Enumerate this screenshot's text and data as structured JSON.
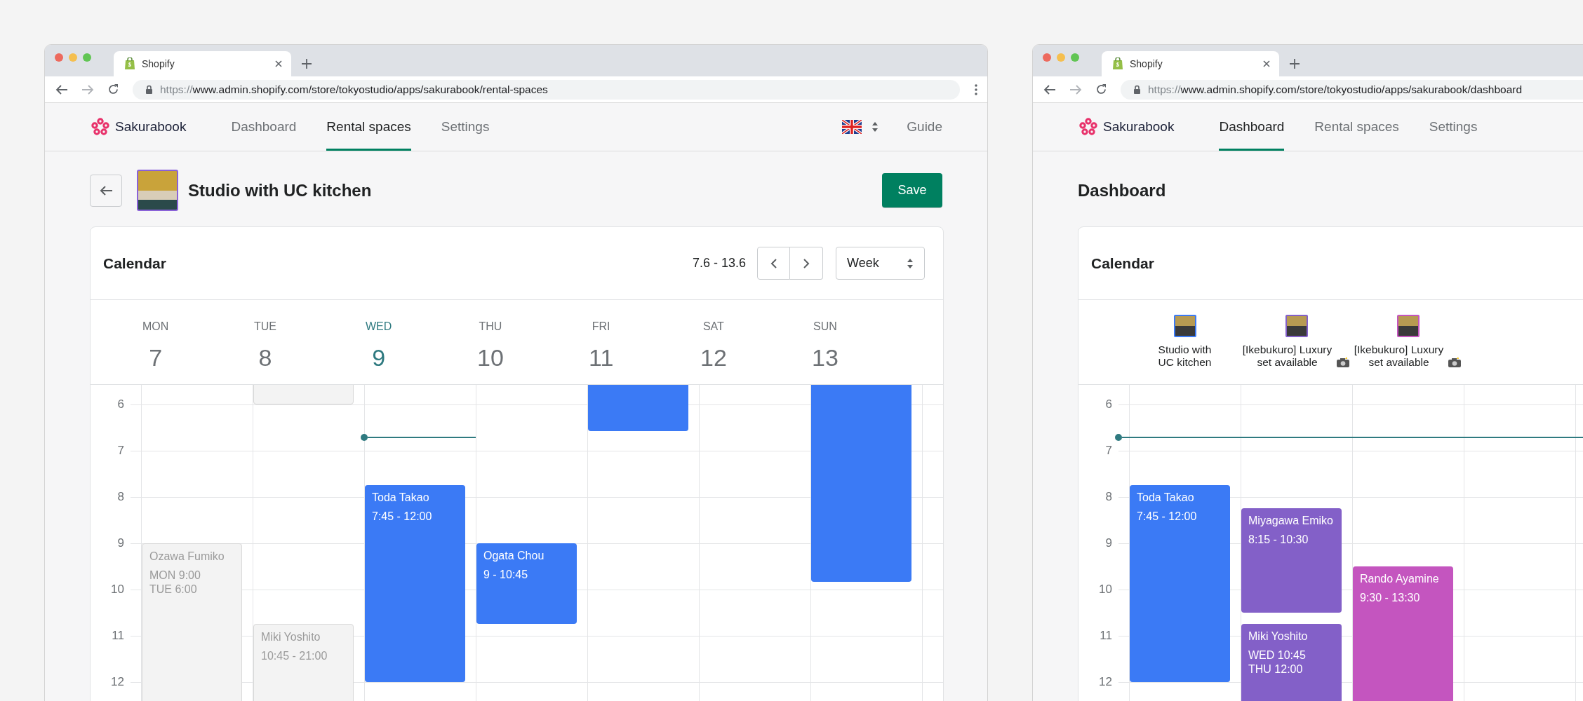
{
  "windows": [
    {
      "tab": {
        "title": "Shopify"
      },
      "url": {
        "scheme": "https://",
        "rest": "www.admin.shopify.com/store/tokyostudio/apps/sakurabook/rental-spaces"
      },
      "app": {
        "logo": "Sakurabook",
        "nav": [
          {
            "label": "Dashboard",
            "selected": false
          },
          {
            "label": "Rental spaces",
            "selected": true
          },
          {
            "label": "Settings",
            "selected": false
          }
        ],
        "language_picker": true,
        "guide": "Guide"
      },
      "page": {
        "kind": "space",
        "title": "Studio with UC kitchen",
        "save": "Save",
        "calendar": {
          "title": "Calendar",
          "range": "7.6 - 13.6",
          "view": "Week",
          "now_line": true,
          "hours": [
            "6",
            "7",
            "8",
            "9",
            "10",
            "11",
            "12"
          ],
          "days": [
            {
              "name": "MON",
              "date": "7",
              "selected": false,
              "events": [
                {
                  "kind": "muted",
                  "name": "Ozawa Fumiko",
                  "details": [
                    "MON 9:00",
                    "TUE 6:00"
                  ]
                }
              ]
            },
            {
              "name": "TUE",
              "date": "8",
              "selected": false,
              "events": [
                {
                  "kind": "muted"
                },
                {
                  "kind": "muted",
                  "name": "Miki Yoshito",
                  "details": [
                    "10:45 - 21:00"
                  ]
                }
              ]
            },
            {
              "name": "WED",
              "date": "9",
              "selected": true,
              "events": [
                {
                  "kind": "booked",
                  "name": "Toda Takao",
                  "details": [
                    "7:45 - 12:00"
                  ],
                  "color": "#3b7af5"
                }
              ]
            },
            {
              "name": "THU",
              "date": "10",
              "selected": false,
              "events": [
                {
                  "kind": "booked",
                  "name": "Ogata Chou",
                  "details": [
                    "9 - 10:45"
                  ],
                  "color": "#3b7af5"
                }
              ]
            },
            {
              "name": "FRI",
              "date": "11",
              "selected": false,
              "events": [
                {
                  "kind": "booked",
                  "color": "#3b7af5"
                }
              ]
            },
            {
              "name": "SAT",
              "date": "12",
              "selected": false
            },
            {
              "name": "SUN",
              "date": "13",
              "selected": false,
              "events": [
                {
                  "kind": "booked",
                  "color": "#3b7af5"
                }
              ]
            }
          ]
        }
      }
    },
    {
      "tab": {
        "title": "Shopify"
      },
      "url": {
        "scheme": "https://",
        "rest": "www.admin.shopify.com/store/tokyostudio/apps/sakurabook/dashboard"
      },
      "app": {
        "logo": "Sakurabook",
        "nav": [
          {
            "label": "Dashboard",
            "selected": true
          },
          {
            "label": "Rental spaces",
            "selected": false
          },
          {
            "label": "Settings",
            "selected": false
          }
        ]
      },
      "page": {
        "kind": "dashboard",
        "title": "Dashboard",
        "calendar": {
          "title": "Calendar",
          "now_line": true,
          "hours": [
            "6",
            "7",
            "8",
            "9",
            "10",
            "11",
            "12"
          ],
          "resources": [
            {
              "name": "Studio with\nUC kitchen",
              "color": "#3b7af5",
              "camera": false,
              "events": [
                {
                  "kind": "booked",
                  "name": "Toda Takao",
                  "details": [
                    "7:45 - 12:00"
                  ],
                  "color": "#3b7af5"
                }
              ]
            },
            {
              "name": "[Ikebukuro] Luxury\nset available",
              "color": "#8360c8",
              "camera": true,
              "events": [
                {
                  "kind": "booked",
                  "name": "Miyagawa Emiko",
                  "details": [
                    "8:15 - 10:30"
                  ],
                  "color": "#8360c8"
                },
                {
                  "kind": "booked",
                  "name": "Miki Yoshito",
                  "details": [
                    "WED 10:45",
                    "THU 12:00"
                  ],
                  "color": "#8360c8"
                }
              ]
            },
            {
              "name": "[Ikebukuro] Luxury\nset available",
              "color": "#c455bf",
              "camera": true,
              "events": [
                {
                  "kind": "booked",
                  "name": "Rando Ayamine",
                  "details": [
                    "9:30 - 13:30"
                  ],
                  "color": "#c455bf"
                }
              ]
            }
          ]
        }
      }
    }
  ]
}
